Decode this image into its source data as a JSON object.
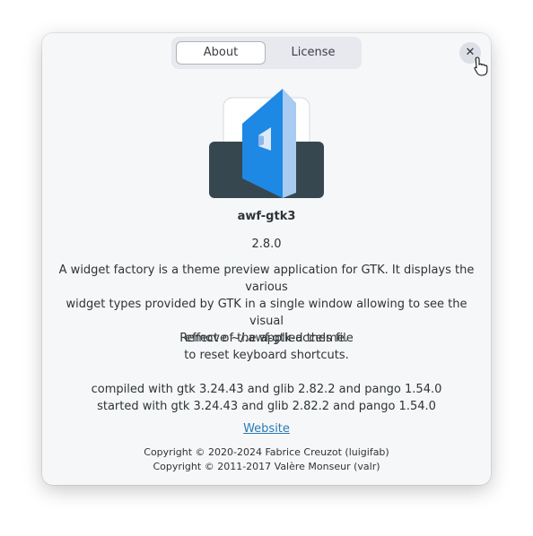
{
  "tabs": [
    {
      "label": "About",
      "active": true
    },
    {
      "label": "License",
      "active": false
    }
  ],
  "close_glyph": "✕",
  "app": {
    "name": "awf-gtk3",
    "version": "2.8.0",
    "icon_name": "awf-gtk3-app-icon",
    "description_lines": [
      "A widget factory is a theme preview application for GTK. It displays the various",
      "widget types provided by GTK in a single window allowing to see the visual",
      "effect of the applied theme."
    ],
    "note_lines": [
      "Remove ~/.awf-gtk-accels file",
      "to reset keyboard shortcuts."
    ],
    "version_lines": [
      "compiled with gtk 3.24.43 and glib 2.82.2 and pango 1.54.0",
      "started with gtk 3.24.43 and glib 2.82.2 and pango 1.54.0"
    ],
    "website_label": "Website",
    "copyright_lines": [
      "Copyright © 2020-2024 Fabrice Creuzot (luigifab)",
      "Copyright © 2011-2017 Valère Monseur (valr)"
    ]
  },
  "colors": {
    "dialog_bg": "#f6f7f9",
    "icon_blue": "#1e88e5",
    "icon_dark": "#37474f",
    "link": "#2a7bb4"
  }
}
